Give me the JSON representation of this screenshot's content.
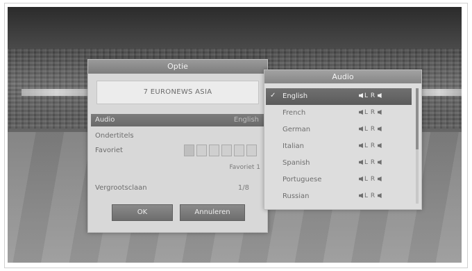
{
  "dialog": {
    "title": "Optie",
    "channel": "7 EURONEWS ASIA",
    "audio_label": "Audio",
    "audio_value": "English",
    "subtitles_label": "Ondertitels",
    "favorite_label": "Favoriet",
    "favorite_selected": "Favoriet 1",
    "zoom_label": "Vergrootsclaan",
    "zoom_value": "1/8",
    "ok_label": "OK",
    "cancel_label": "Annuleren"
  },
  "audio_panel": {
    "title": "Audio",
    "channel_mode": "L  R",
    "languages": [
      {
        "name": "English",
        "selected": true
      },
      {
        "name": "French",
        "selected": false
      },
      {
        "name": "German",
        "selected": false
      },
      {
        "name": "Italian",
        "selected": false
      },
      {
        "name": "Spanish",
        "selected": false
      },
      {
        "name": "Portuguese",
        "selected": false
      },
      {
        "name": "Russian",
        "selected": false
      }
    ]
  },
  "icons": {
    "check": "check-icon",
    "speaker": "speaker-icon"
  }
}
